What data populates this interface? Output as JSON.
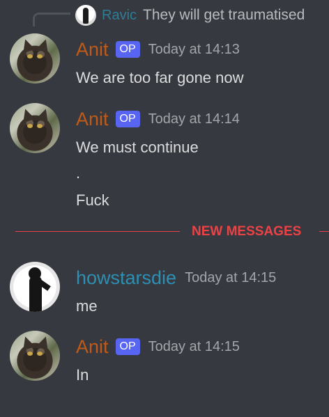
{
  "reply": {
    "author": "Ravic",
    "text": "They will get traumatised"
  },
  "messages": [
    {
      "author": "Anit",
      "badge": "OP",
      "timestamp": "Today at 14:13",
      "lines": [
        "We are too far gone now"
      ]
    },
    {
      "author": "Anit",
      "badge": "OP",
      "timestamp": "Today at 14:14",
      "lines": [
        "We must continue",
        ".",
        "Fuck"
      ]
    },
    {
      "author": "howstarsdie",
      "timestamp": "Today at 14:15",
      "lines": [
        "me"
      ]
    },
    {
      "author": "Anit",
      "badge": "OP",
      "timestamp": "Today at 14:15",
      "lines": [
        "In"
      ]
    }
  ],
  "divider": {
    "label": "NEW MESSAGES"
  },
  "colors": {
    "background": "#36393f",
    "anit_name": "#c15a18",
    "howstarsdie_name": "#2d8fb3",
    "reply_name": "#2d7d9a",
    "op_badge": "#5865f2",
    "new_messages": "#ed4245",
    "message_text": "#dcddde",
    "timestamp": "#a3a6aa"
  },
  "icons": {
    "reply_avatar": "user-avatar-icon",
    "anit_avatar": "cat-avatar-icon",
    "howstarsdie_avatar": "figure-avatar-icon"
  }
}
